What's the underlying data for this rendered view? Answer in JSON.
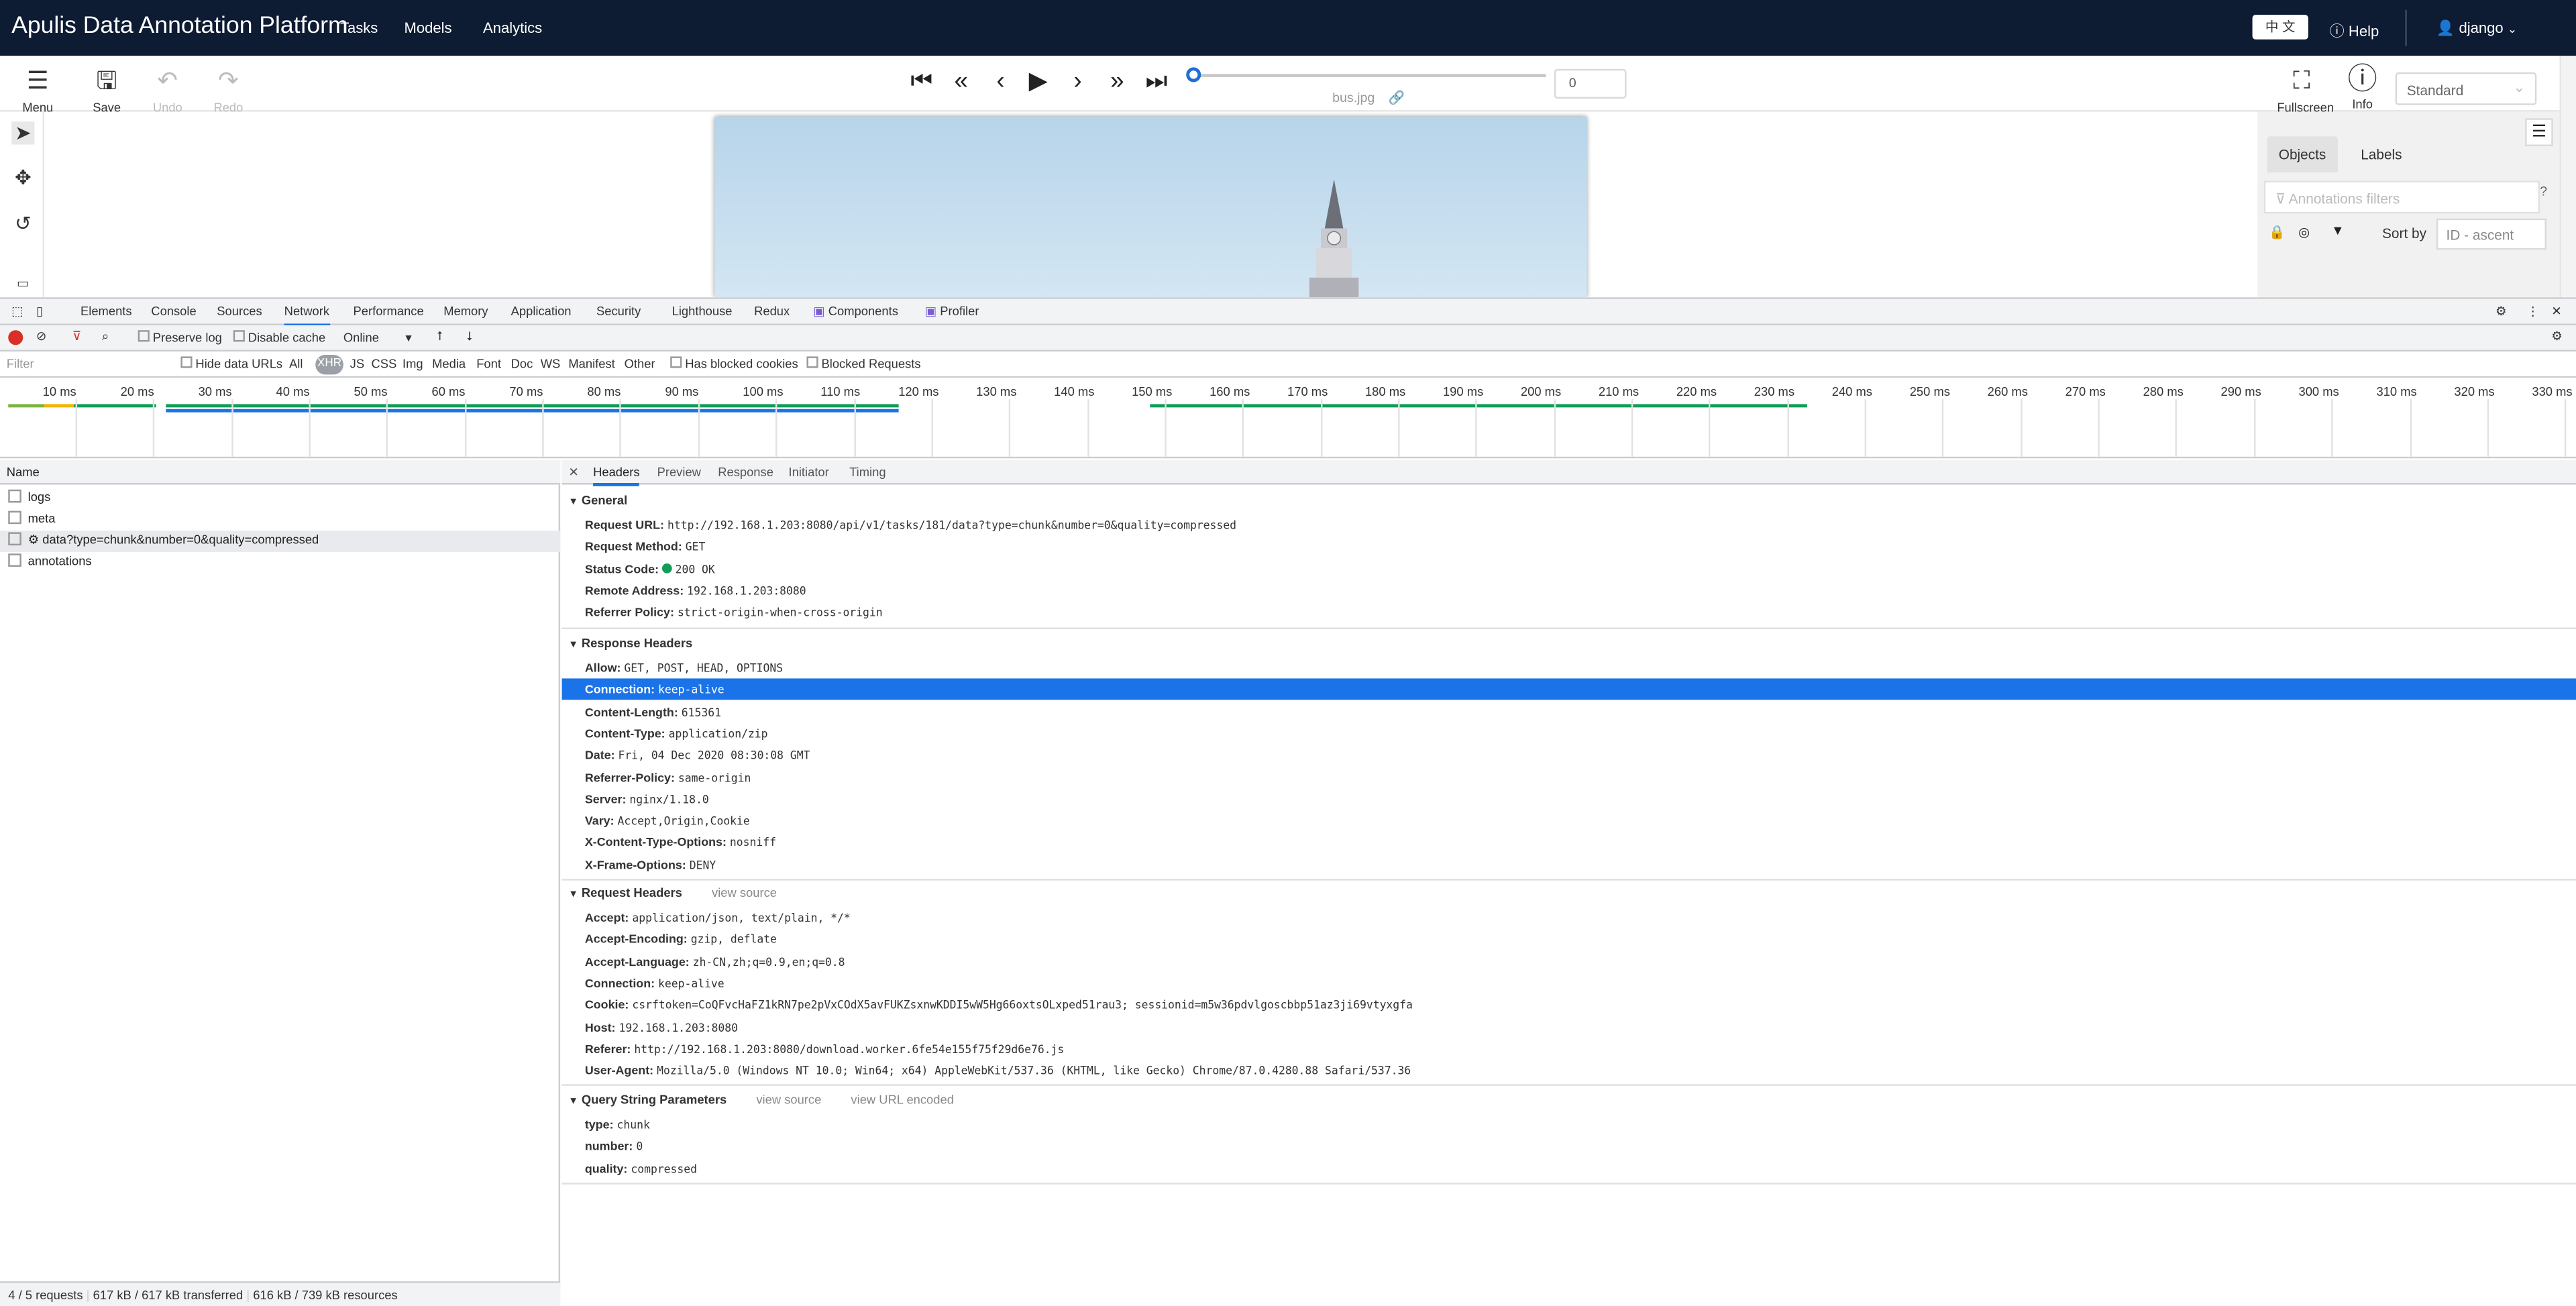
{
  "app": {
    "brand": "Apulis Data Annotation Platform",
    "nav": [
      "Tasks",
      "Models",
      "Analytics"
    ],
    "lang": "中 文",
    "help": "Help",
    "user": "django"
  },
  "toolbar": {
    "menu": "Menu",
    "save": "Save",
    "undo": "Undo",
    "redo": "Redo",
    "frame_value": "0",
    "filename": "bus.jpg",
    "fullscreen": "Fullscreen",
    "info": "Info",
    "workspace": "Standard"
  },
  "right_panel": {
    "tabs": [
      "Objects",
      "Labels"
    ],
    "filter_placeholder": "Annotations filters",
    "sort_label": "Sort by",
    "sort_value": "ID - ascent"
  },
  "devtools": {
    "tabs": [
      "Elements",
      "Console",
      "Sources",
      "Network",
      "Performance",
      "Memory",
      "Application",
      "Security",
      "Lighthouse",
      "Redux",
      "Components",
      "Profiler"
    ],
    "preserve_log": "Preserve log",
    "disable_cache": "Disable cache",
    "throttle": "Online",
    "filter_placeholder": "Filter",
    "hide_data_urls": "Hide data URLs",
    "types": [
      "All",
      "XHR",
      "JS",
      "CSS",
      "Img",
      "Media",
      "Font",
      "Doc",
      "WS",
      "Manifest",
      "Other"
    ],
    "has_blocked_cookies": "Has blocked cookies",
    "blocked_requests": "Blocked Requests",
    "ticks": [
      "10 ms",
      "20 ms",
      "30 ms",
      "40 ms",
      "50 ms",
      "60 ms",
      "70 ms",
      "80 ms",
      "90 ms",
      "100 ms",
      "110 ms",
      "120 ms",
      "130 ms",
      "140 ms",
      "150 ms",
      "160 ms",
      "170 ms",
      "180 ms",
      "190 ms",
      "200 ms",
      "210 ms",
      "220 ms",
      "230 ms",
      "240 ms",
      "250 ms",
      "260 ms",
      "270 ms",
      "280 ms",
      "290 ms",
      "300 ms",
      "310 ms",
      "320 ms",
      "330 ms"
    ],
    "name_header": "Name",
    "requests": [
      "logs",
      "meta",
      "data?type=chunk&number=0&quality=compressed",
      "annotations"
    ],
    "status": [
      "4 / 5 requests",
      "617 kB / 617 kB transferred",
      "616 kB / 739 kB resources"
    ],
    "detail_tabs": [
      "Headers",
      "Preview",
      "Response",
      "Initiator",
      "Timing"
    ],
    "general_title": "General",
    "general": [
      {
        "k": "Request URL:",
        "v": "http://192.168.1.203:8080/api/v1/tasks/181/data?type=chunk&number=0&quality=compressed"
      },
      {
        "k": "Request Method:",
        "v": "GET"
      },
      {
        "k": "Status Code:",
        "v": "200 OK"
      },
      {
        "k": "Remote Address:",
        "v": "192.168.1.203:8080"
      },
      {
        "k": "Referrer Policy:",
        "v": "strict-origin-when-cross-origin"
      }
    ],
    "response_title": "Response Headers",
    "response": [
      {
        "k": "Allow:",
        "v": "GET, POST, HEAD, OPTIONS"
      },
      {
        "k": "Connection:",
        "v": "keep-alive"
      },
      {
        "k": "Content-Length:",
        "v": "615361"
      },
      {
        "k": "Content-Type:",
        "v": "application/zip"
      },
      {
        "k": "Date:",
        "v": "Fri, 04 Dec 2020 08:30:08 GMT"
      },
      {
        "k": "Referrer-Policy:",
        "v": "same-origin"
      },
      {
        "k": "Server:",
        "v": "nginx/1.18.0"
      },
      {
        "k": "Vary:",
        "v": "Accept,Origin,Cookie"
      },
      {
        "k": "X-Content-Type-Options:",
        "v": "nosniff"
      },
      {
        "k": "X-Frame-Options:",
        "v": "DENY"
      }
    ],
    "request_title": "Request Headers",
    "view_source": "view source",
    "request": [
      {
        "k": "Accept:",
        "v": "application/json, text/plain, */*"
      },
      {
        "k": "Accept-Encoding:",
        "v": "gzip, deflate"
      },
      {
        "k": "Accept-Language:",
        "v": "zh-CN,zh;q=0.9,en;q=0.8"
      },
      {
        "k": "Connection:",
        "v": "keep-alive"
      },
      {
        "k": "Cookie:",
        "v": "csrftoken=CoQFvcHaFZ1kRN7pe2pVxCOdX5avFUKZsxnwKDDI5wW5Hg66oxtsOLxped51rau3; sessionid=m5w36pdvlgoscbbp51az3ji69vtyxgfa"
      },
      {
        "k": "Host:",
        "v": "192.168.1.203:8080"
      },
      {
        "k": "Referer:",
        "v": "http://192.168.1.203:8080/download.worker.6fe54e155f75f29d6e76.js"
      },
      {
        "k": "User-Agent:",
        "v": "Mozilla/5.0 (Windows NT 10.0; Win64; x64) AppleWebKit/537.36 (KHTML, like Gecko) Chrome/87.0.4280.88 Safari/537.36"
      }
    ],
    "query_title": "Query String Parameters",
    "view_url_encoded": "view URL encoded",
    "query": [
      {
        "k": "type:",
        "v": "chunk"
      },
      {
        "k": "number:",
        "v": "0"
      },
      {
        "k": "quality:",
        "v": "compressed"
      }
    ]
  }
}
